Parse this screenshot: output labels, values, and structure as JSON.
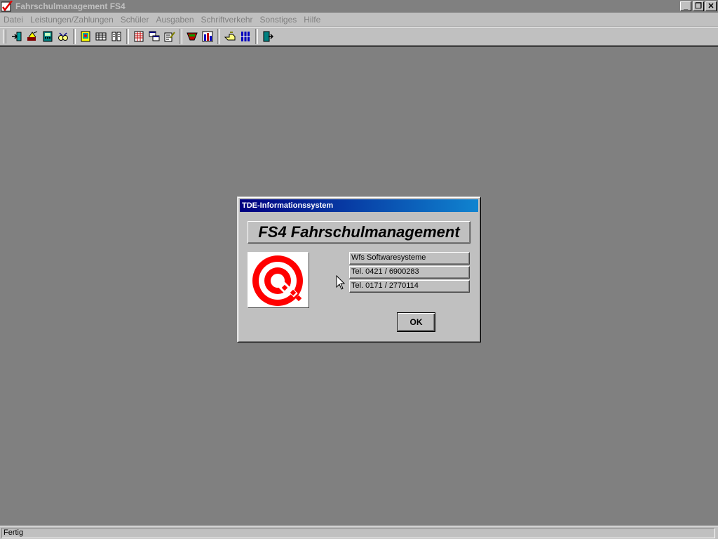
{
  "window": {
    "title": "Fahrschulmanagement FS4",
    "controls": {
      "minimize": "_",
      "restore": "❐",
      "close": "✕"
    }
  },
  "menu": [
    {
      "label": "Datei"
    },
    {
      "label": "Leistungen/Zahlungen"
    },
    {
      "label": "Schüler"
    },
    {
      "label": "Ausgaben"
    },
    {
      "label": "Schriftverkehr"
    },
    {
      "label": "Sonstiges"
    },
    {
      "label": "Hilfe"
    }
  ],
  "toolbar": {
    "groups": [
      [
        "login-icon",
        "sign-icon",
        "calculator-icon",
        "glasses-icon"
      ],
      [
        "certificate-icon",
        "grid-icon",
        "book-icon"
      ],
      [
        "table-icon",
        "cascade-icon",
        "edit-icon"
      ],
      [
        "car-icon",
        "chart-icon"
      ],
      [
        "hand-icon",
        "columns-icon"
      ],
      [
        "exit-icon"
      ]
    ]
  },
  "dialog": {
    "title": "TDE-Informationssystem",
    "heading": "FS4 Fahrschulmanagement",
    "info": [
      "Wfs Softwaresysteme",
      "Tel. 0421 / 6900283",
      "Tel. 0171 / 2770114"
    ],
    "ok_label": "OK",
    "logo_color": "#ff0000"
  },
  "status": {
    "text": "Fertig"
  }
}
